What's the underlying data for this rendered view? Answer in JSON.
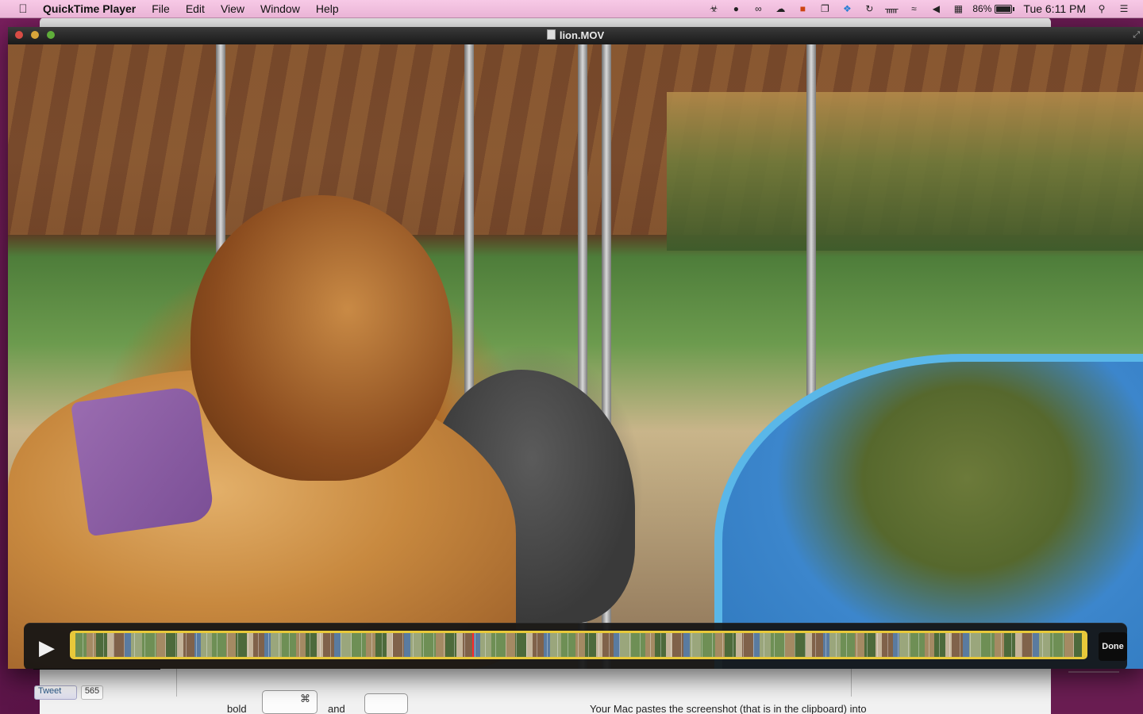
{
  "menubar": {
    "apple_icon": "apple-logo",
    "app_name": "QuickTime Player",
    "menus": [
      "File",
      "Edit",
      "View",
      "Window",
      "Help"
    ],
    "tray_icons": [
      "evernote-icon",
      "skype-icon",
      "glasses-icon",
      "cloud-icon",
      "pdf-icon",
      "screens-icon",
      "dropbox-icon",
      "time-machine-icon",
      "bluetooth-icon",
      "wifi-icon",
      "volume-icon",
      "calendar-icon"
    ],
    "battery_percent": "86%",
    "battery_level": 0.86,
    "clock": "Tue 6:11 PM"
  },
  "qt": {
    "title": "lion.MOV",
    "play_icon": "play-icon",
    "done_label": "Done",
    "playhead_fraction": 0.395,
    "colors": {
      "trim_border": "#e8c93a",
      "playhead": "#ff2a2a"
    }
  },
  "background_page": {
    "tweet_label": "Tweet",
    "tweet_count": "565",
    "text_bold": "bold",
    "key_cmd": "⌘",
    "text_and": "and",
    "sentence": "Your Mac pastes the screenshot (that is in the clipboard) into"
  }
}
